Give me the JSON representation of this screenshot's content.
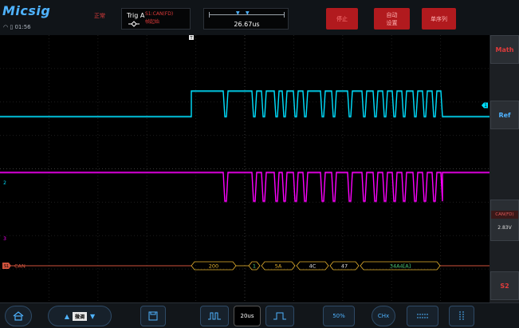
{
  "topbar": {
    "brand": "Micsig",
    "clock": "01:56",
    "run_status": "正常",
    "trigger": {
      "label": "Trig A",
      "source": "S1:CAN(FD)",
      "edge": "帧起始"
    },
    "timebase": {
      "offset": "26.67us"
    },
    "buttons": {
      "stop": "停止",
      "auto": "自动\n设置",
      "single": "单序列"
    }
  },
  "screen": {
    "ch1_marker": "1",
    "ch2_marker": "2",
    "ch3_marker": "3",
    "trigger_marker": "T",
    "bus": {
      "label": "CAN",
      "marker": "S1",
      "frames": [
        {
          "text": "200",
          "color": "#e6b32e"
        },
        {
          "text": "1",
          "color": "#4fd17a"
        },
        {
          "text": "5A",
          "color": "#e6b32e"
        },
        {
          "text": "4C",
          "color": "#e6e6e6"
        },
        {
          "text": "47",
          "color": "#e6e6e6"
        },
        {
          "text": "34A4[A]",
          "color": "#4fd17a"
        }
      ]
    },
    "colors": {
      "ch1": "#00e1ff",
      "ch2": "#ff00ff",
      "bus": "#d0523c"
    }
  },
  "rightpanel": {
    "math": "Math",
    "ref": "Ref",
    "can_header": "CAN(FD)",
    "can_value": "2.83V",
    "s2": "S2"
  },
  "bottombar": {
    "tune_label": "微调",
    "timebase_value": "20us",
    "percent": "50%",
    "channel": "CHx"
  }
}
